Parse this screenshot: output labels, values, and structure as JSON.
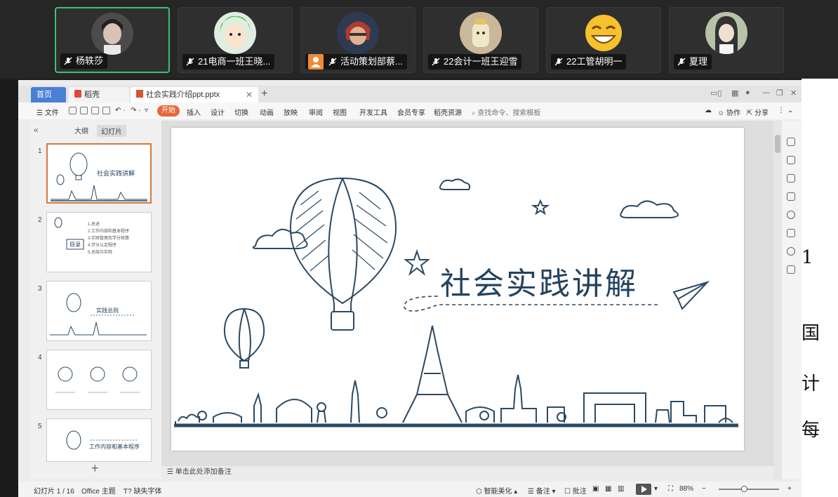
{
  "participants": [
    {
      "name": "杨轶莎",
      "active": true
    },
    {
      "name": "21电商一班王晓..."
    },
    {
      "name": "活动策划部蔡...",
      "host": true
    },
    {
      "name": "22会计一班王迎雪"
    },
    {
      "name": "22工管胡明一"
    },
    {
      "name": "夏理"
    }
  ],
  "tabs": {
    "home": "首页",
    "daoke": "稻壳",
    "doc": "社会实践介绍ppt.pptx"
  },
  "ribbon": {
    "file": "文件",
    "items": [
      "开始",
      "插入",
      "设计",
      "切换",
      "动画",
      "放映",
      "审阅",
      "视图",
      "开发工具",
      "会员专享",
      "稻壳资源"
    ],
    "search": "查找命令、搜索模板",
    "collab": "协作",
    "share": "分享"
  },
  "pane": {
    "outline": "大纲",
    "slides": "幻灯片"
  },
  "thumbs": [
    {
      "num": "1",
      "title": "社会实践讲解"
    },
    {
      "num": "2",
      "title": "目录",
      "items": [
        "1.总述",
        "2.工作内容和基本程序",
        "3.实践管理及学分核算",
        "4.学分认定程序",
        "5.总结与实践"
      ]
    },
    {
      "num": "3",
      "title": "实践总则"
    },
    {
      "num": "4",
      "title": ""
    },
    {
      "num": "5",
      "title": "工作内容和基本程序"
    }
  ],
  "slide": {
    "title": "社会实践讲解"
  },
  "notes": "单击此处添加备注",
  "status": {
    "slide_no": "幻灯片 1 / 16",
    "theme": "Office 主题",
    "font_missing": "缺失字体",
    "beautify": "智能美化",
    "remarks": "备注",
    "comments": "批注",
    "zoom": "88%"
  },
  "edge_chars": [
    "1",
    "国",
    "计",
    "每"
  ]
}
